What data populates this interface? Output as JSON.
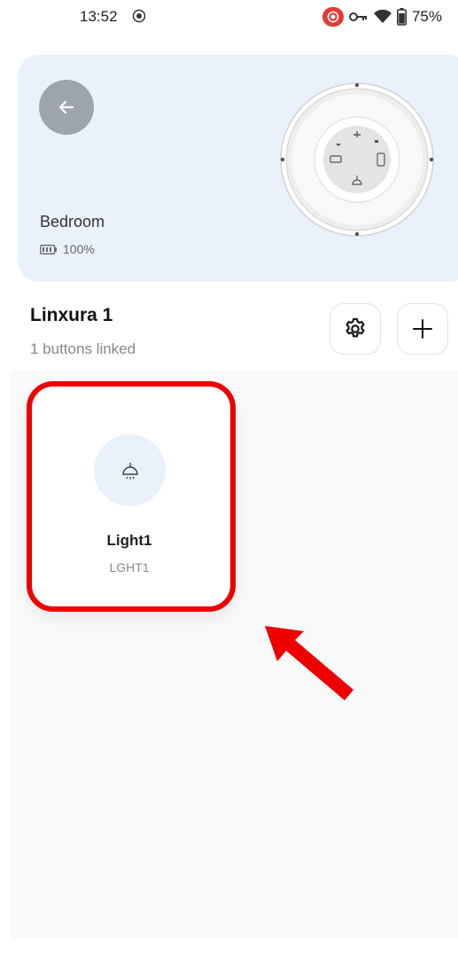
{
  "status_bar": {
    "time": "13:52",
    "battery_percent": "75%",
    "icons": [
      "screen-record-icon",
      "vpn-key-icon",
      "wifi-icon",
      "battery-icon"
    ]
  },
  "device": {
    "room": "Bedroom",
    "battery": "100%",
    "icons": [
      "back-arrow-icon",
      "battery-small-icon"
    ]
  },
  "group": {
    "title": "Linxura 1",
    "subtitle": "1 buttons linked",
    "icons": [
      "gear-icon",
      "plus-icon"
    ]
  },
  "buttons": [
    {
      "name": "Light1",
      "code": "LGHT1",
      "icon": "ceiling-light-icon"
    }
  ],
  "colors": {
    "card_bg": "#eaf1fa",
    "back_button": "#9ea4ab",
    "annotation_red": "#ee0000"
  }
}
